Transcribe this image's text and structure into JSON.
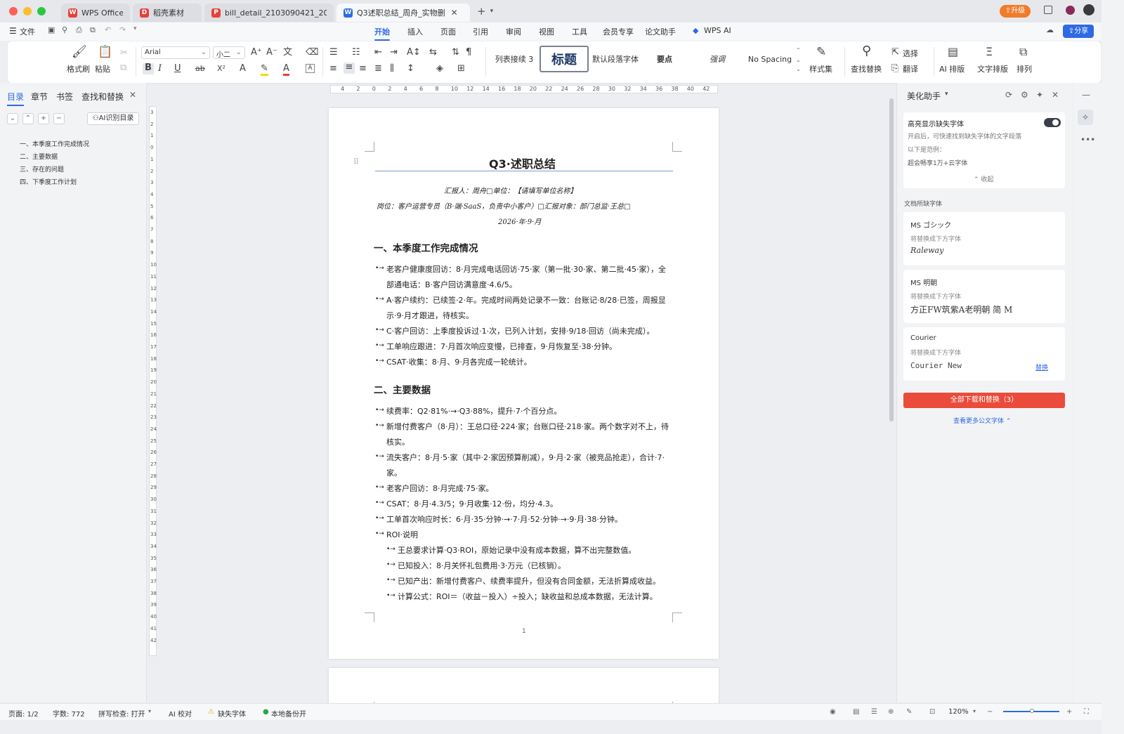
{
  "tabs": [
    {
      "label": "WPS Office",
      "icon": "wps-logo-icon",
      "color": "#e5413a",
      "active": false
    },
    {
      "label": "稻壳素材",
      "icon": "docer-icon",
      "color": "#e5413a",
      "active": false
    },
    {
      "label": "bill_detail_2103090421_2026",
      "icon": "pdf-icon",
      "color": "#e5413a",
      "active": false
    },
    {
      "label": "Q3述职总结_周舟_实物删",
      "icon": "word-icon",
      "color": "#2f6ae4",
      "active": true
    }
  ],
  "upgrade_label": "升级",
  "menubar": {
    "file": "文件",
    "tabs": [
      "开始",
      "插入",
      "页面",
      "引用",
      "审阅",
      "视图",
      "工具",
      "会员专享",
      "论文助手",
      "WPS AI"
    ],
    "share": "分享"
  },
  "ribbon": {
    "format_painter": "格式刷",
    "paste": "粘贴",
    "font": "Arial",
    "size": "小二",
    "styles": [
      "列表接续 3",
      "标题",
      "默认段落字体",
      "要点",
      "强调",
      "No Spacing"
    ],
    "style_set": "样式集",
    "find_replace": "查找替换",
    "select": "选择",
    "translate": "翻译",
    "ai_layout": "AI 排版",
    "text_layout": "文字排版",
    "arrange": "排列"
  },
  "left_panel": {
    "tabs": [
      "目录",
      "章节",
      "书签",
      "查找和替换"
    ],
    "ai_button": "AI识别目录",
    "toc": [
      "一、本季度工作完成情况",
      "二、主要数据",
      "三、存在的问题",
      "四、下季度工作计划"
    ]
  },
  "document": {
    "title": "Q3·述职总结",
    "meta1": "汇报人：周舟□单位：【请填写单位名称】",
    "meta2": "岗位：客户运营专员（B·端·SaaS，负责中小客户）□汇报对象：部门总监·王总□",
    "meta3": "2026·年·9·月",
    "h1": "一、本季度工作完成情况",
    "s1": [
      "老客户健康度回访：8·月完成电话回访·75·家（第一批·30·家、第二批·45·家），全",
      "部通电话：B·客户回访满意度·4.6/5。",
      "A·客户续约：已续签·2·年。完成时间两处记录不一致：台账记·8/28·已签，周报显",
      "示·9·月才跟进，待核实。",
      "C·客户回访：上季度投诉过·1·次，已列入计划，安排·9/18·回访（尚未完成）。",
      "工单响应跟进：7·月首次响应变慢，已排查，9·月恢复至·38·分钟。",
      "CSAT·收集：8·月、9·月各完成一轮统计。"
    ],
    "h2": "二、主要数据",
    "s2": [
      "续费率：Q2·81%·→·Q3·88%，提升·7·个百分点。",
      "新增付费客户（8·月）：王总口径·224·家；台账口径·218·家。两个数字对不上，待",
      "核实。",
      "流失客户：8·月·5·家（其中·2·家因预算削减），9·月·2·家（被竞品抢走），合计·7·",
      "家。",
      "老客户回访：8·月完成·75·家。",
      "CSAT：8·月·4.3/5；9·月收集·12·份，均分·4.3。",
      "工单首次响应时长：6·月·35·分钟·→·7·月·52·分钟·→·9·月·38·分钟。",
      "ROI·说明",
      "王总要求计算·Q3·ROI，原始记录中没有成本数据，算不出完整数值。",
      "已知投入：8·月关怀礼包费用·3·万元（已核销）。",
      "已知产出：新增付费客户、续费率提升，但没有合同金额，无法折算成收益。",
      "计算公式：ROI＝（收益－投入）÷投入；缺收益和总成本数据，无法计算。"
    ],
    "page_num": "1"
  },
  "right_panel": {
    "title": "美化助手",
    "highlight_title": "高亮显示缺失字体",
    "highlight_desc": "开启后，可快速找到缺失字体的文字段落",
    "example_label": "以下是范例：",
    "example_text": "超会畅享1万+云字体",
    "collapse": "收起",
    "missing_label": "文档所缺字体",
    "fonts": [
      {
        "name": "MS ゴシック",
        "replace_label": "将替换成下方字体",
        "replacement": "Raleway"
      },
      {
        "name": "MS 明朝",
        "replace_label": "将替换成下方字体",
        "replacement": "方正FW筑紫A老明朝 简 M"
      },
      {
        "name": "Courier",
        "replace_label": "将替换成下方字体",
        "replacement": "Courier New",
        "action": "替换"
      }
    ],
    "download_all": "全部下载和替换（3）",
    "more_link": "查看更多公文字体"
  },
  "status": {
    "page": "页面: 1/2",
    "words": "字数: 772",
    "spell": "拼写检查: 打开",
    "ai_check": "AI 校对",
    "missing_font": "缺失字体",
    "backup": "本地备份开",
    "zoom": "120%"
  },
  "colors": {
    "accent": "#2f6ae4",
    "download": "#ea4b3a",
    "upgrade": "#f07c2a"
  }
}
